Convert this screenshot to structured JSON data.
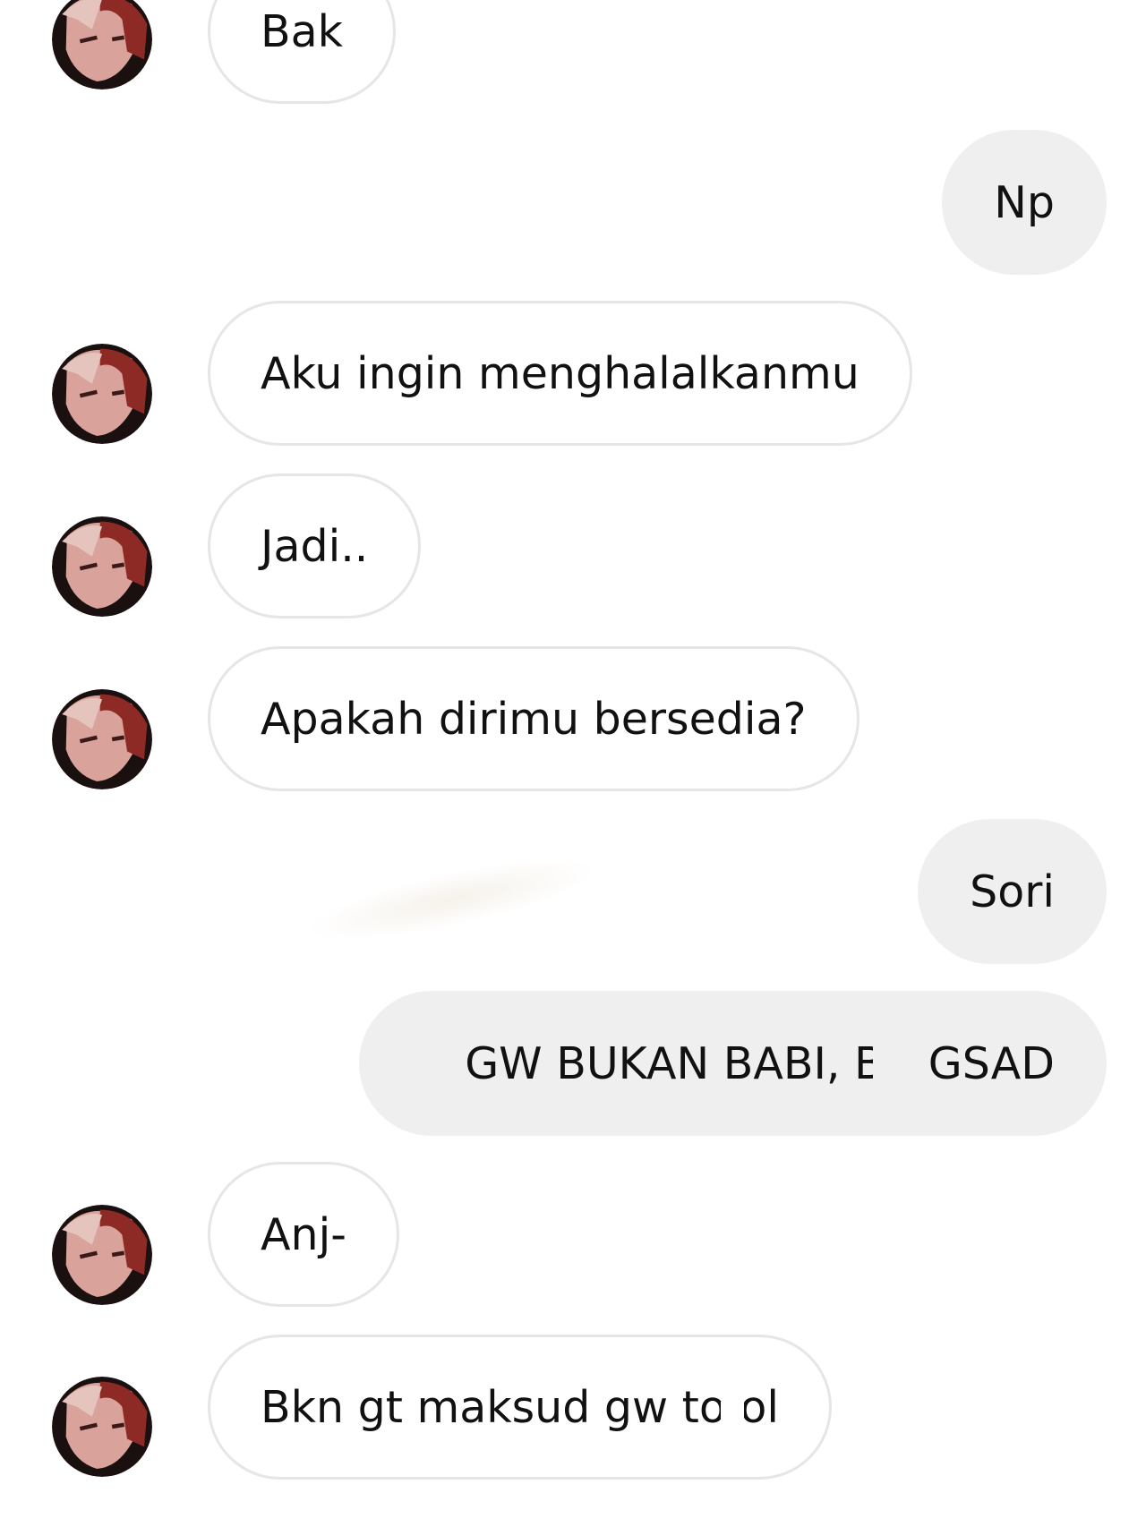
{
  "conversation": {
    "messages": [
      {
        "side": "received",
        "text": "Bak"
      },
      {
        "side": "sent",
        "text": "Np"
      },
      {
        "side": "received",
        "text": "Aku ingin menghalalkanmu"
      },
      {
        "side": "received",
        "text": "Jadi.."
      },
      {
        "side": "received",
        "text": "Apakah dirimu bersedia?"
      },
      {
        "side": "sent",
        "text": "Sori"
      },
      {
        "side": "sent",
        "text": "GW BUKAN BABI, BA GSAD"
      },
      {
        "side": "received",
        "text": "Anj-"
      },
      {
        "side": "received",
        "text": "Bkn gt maksud gw to ol"
      }
    ]
  },
  "colors": {
    "background": "#ffffff",
    "received_bubble": "#ffffff",
    "received_border": "#e6e6e6",
    "sent_bubble": "#efefef",
    "text": "#111111",
    "avatar_hair": "#8e2a25",
    "avatar_skin": "#d9a39b",
    "avatar_dark": "#1a1010"
  },
  "icons": {
    "avatar": "anime-avatar-icon"
  }
}
